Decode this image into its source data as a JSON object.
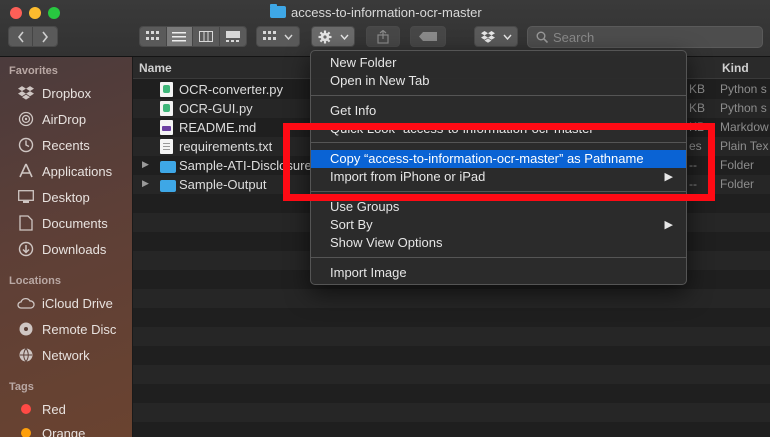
{
  "window": {
    "title": "access-to-information-ocr-master"
  },
  "toolbar": {
    "search_placeholder": "Search"
  },
  "sidebar": {
    "favorites_header": "Favorites",
    "favorites": [
      {
        "label": "Dropbox",
        "icon": "dropbox-icon"
      },
      {
        "label": "AirDrop",
        "icon": "airdrop-icon"
      },
      {
        "label": "Recents",
        "icon": "recents-icon"
      },
      {
        "label": "Applications",
        "icon": "applications-icon"
      },
      {
        "label": "Desktop",
        "icon": "desktop-icon"
      },
      {
        "label": "Documents",
        "icon": "documents-icon"
      },
      {
        "label": "Downloads",
        "icon": "downloads-icon"
      }
    ],
    "locations_header": "Locations",
    "locations": [
      {
        "label": "iCloud Drive",
        "icon": "cloud-icon"
      },
      {
        "label": "Remote Disc",
        "icon": "disc-icon"
      },
      {
        "label": "Network",
        "icon": "network-icon"
      }
    ],
    "tags_header": "Tags",
    "tags": [
      {
        "label": "Red",
        "color": "#ff4a45"
      },
      {
        "label": "Orange",
        "color": "#ff9f0a"
      }
    ]
  },
  "file_list": {
    "columns": {
      "name": "Name",
      "kind": "Kind"
    },
    "rows": [
      {
        "name": "OCR-converter.py",
        "size": "KB",
        "kind": "Python s"
      },
      {
        "name": "OCR-GUI.py",
        "size": "KB",
        "kind": "Python s"
      },
      {
        "name": "README.md",
        "size": "KB",
        "kind": "Markdow"
      },
      {
        "name": "requirements.txt",
        "size": "es",
        "kind": "Plain Tex"
      },
      {
        "name": "Sample-ATI-Disclosure",
        "size": "--",
        "kind": "Folder"
      },
      {
        "name": "Sample-Output",
        "size": "--",
        "kind": "Folder"
      }
    ]
  },
  "context_menu": {
    "items": [
      {
        "label": "New Folder"
      },
      {
        "label": "Open in New Tab"
      },
      {
        "label": "Get Info"
      },
      {
        "label": "Quick Look “access-to-information-ocr-master”"
      },
      {
        "label": "Copy “access-to-information-ocr-master” as Pathname"
      },
      {
        "label": "Import from iPhone or iPad"
      },
      {
        "label": "Use Groups"
      },
      {
        "label": "Sort By"
      },
      {
        "label": "Show View Options"
      },
      {
        "label": "Import Image"
      }
    ],
    "selected_index": 4
  },
  "colors": {
    "menu_highlight": "#0a63d4",
    "annotation_box": "#ff0a14",
    "folder_blue": "#3ea7e6"
  }
}
